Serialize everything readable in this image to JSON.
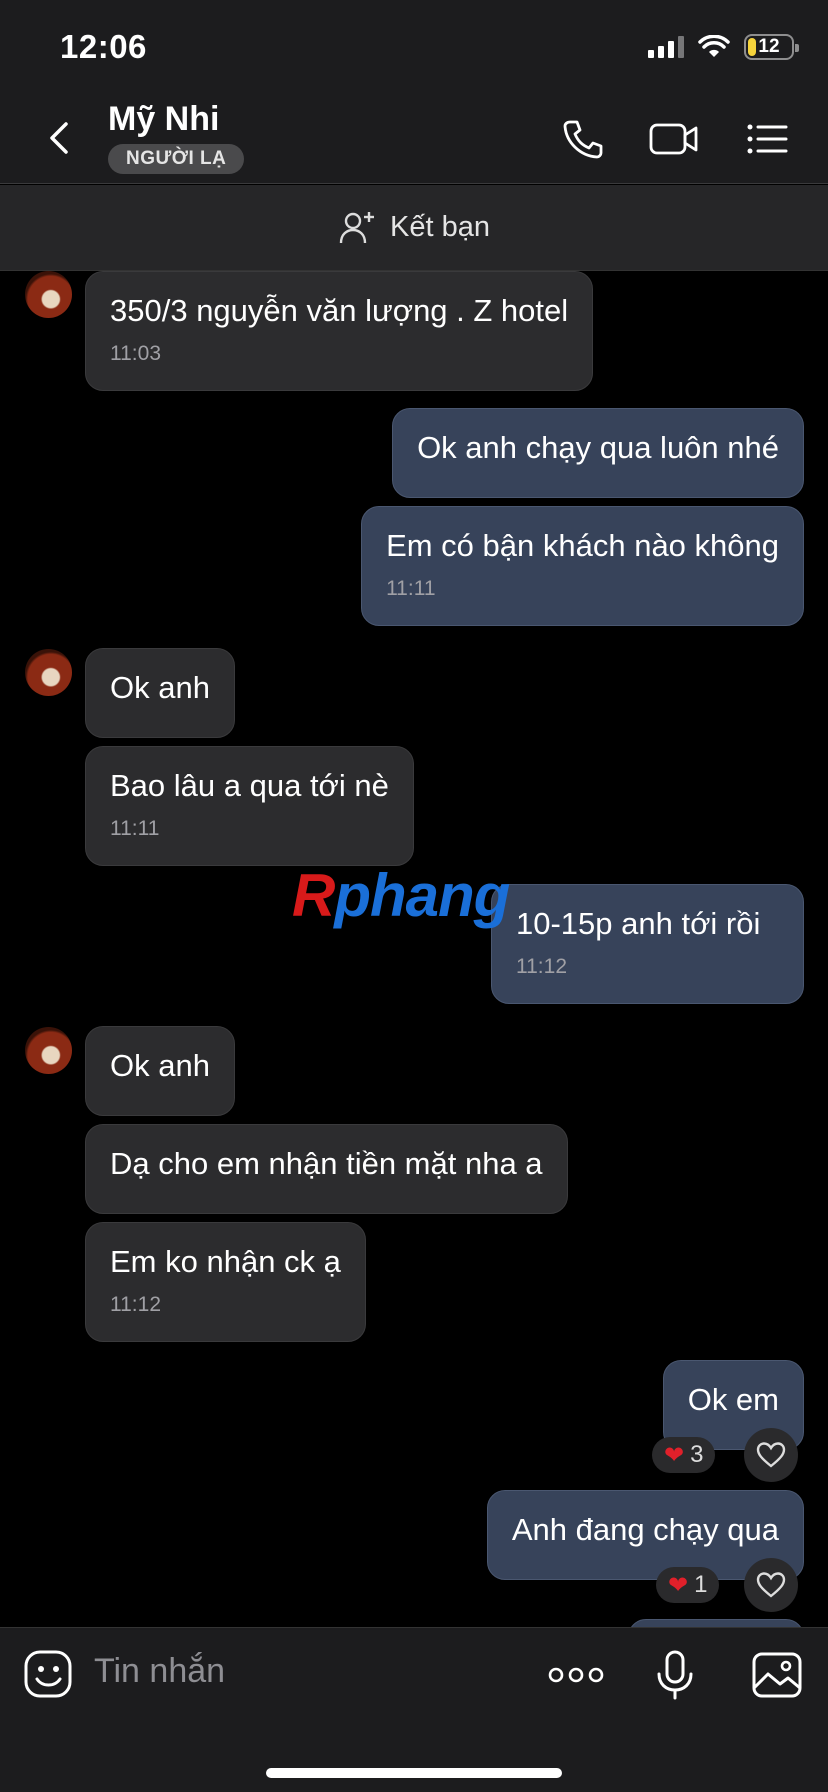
{
  "status_bar": {
    "time": "12:06",
    "battery": "12"
  },
  "header": {
    "contact_name": "Mỹ Nhi",
    "badge": "NGƯỜI LẠ"
  },
  "add_friend": {
    "label": "Kết bạn"
  },
  "messages": [
    {
      "side": "in",
      "text": "350/3 nguyễn văn lượng . Z hotel",
      "time": "11:03"
    },
    {
      "side": "out",
      "text": "Ok anh chạy qua luôn nhé",
      "time": ""
    },
    {
      "side": "out",
      "text": "Em có bận khách nào không",
      "time": "11:11"
    },
    {
      "side": "in",
      "text": "Ok anh",
      "time": ""
    },
    {
      "side": "in",
      "text": "Bao lâu a qua tới nè",
      "time": "11:11"
    },
    {
      "side": "out",
      "text": "10-15p anh tới rồi",
      "time": "11:12"
    },
    {
      "side": "in",
      "text": "Ok anh",
      "time": ""
    },
    {
      "side": "in",
      "text": "Dạ cho em nhận tiền mặt nha a",
      "time": ""
    },
    {
      "side": "in",
      "text": "Em ko nhận ck ạ",
      "time": "11:12"
    },
    {
      "side": "out",
      "text": "Ok em",
      "time": "",
      "reaction_count": "3"
    },
    {
      "side": "out",
      "text": "Anh đang chạy qua",
      "time": "",
      "reaction_count": "1"
    }
  ],
  "watermark": {
    "part1": "R",
    "part2": "phang"
  },
  "composer": {
    "placeholder": "Tin nhắn"
  },
  "colors": {
    "background": "#000000",
    "incoming_bubble": "#2c2c2e",
    "outgoing_bubble": "#37435a",
    "header": "#1c1c1e"
  },
  "icons": [
    "back-icon",
    "phone-icon",
    "video-icon",
    "menu-icon",
    "add-friend-icon",
    "heart-icon",
    "sticker-icon",
    "more-icon",
    "microphone-icon",
    "image-icon"
  ]
}
